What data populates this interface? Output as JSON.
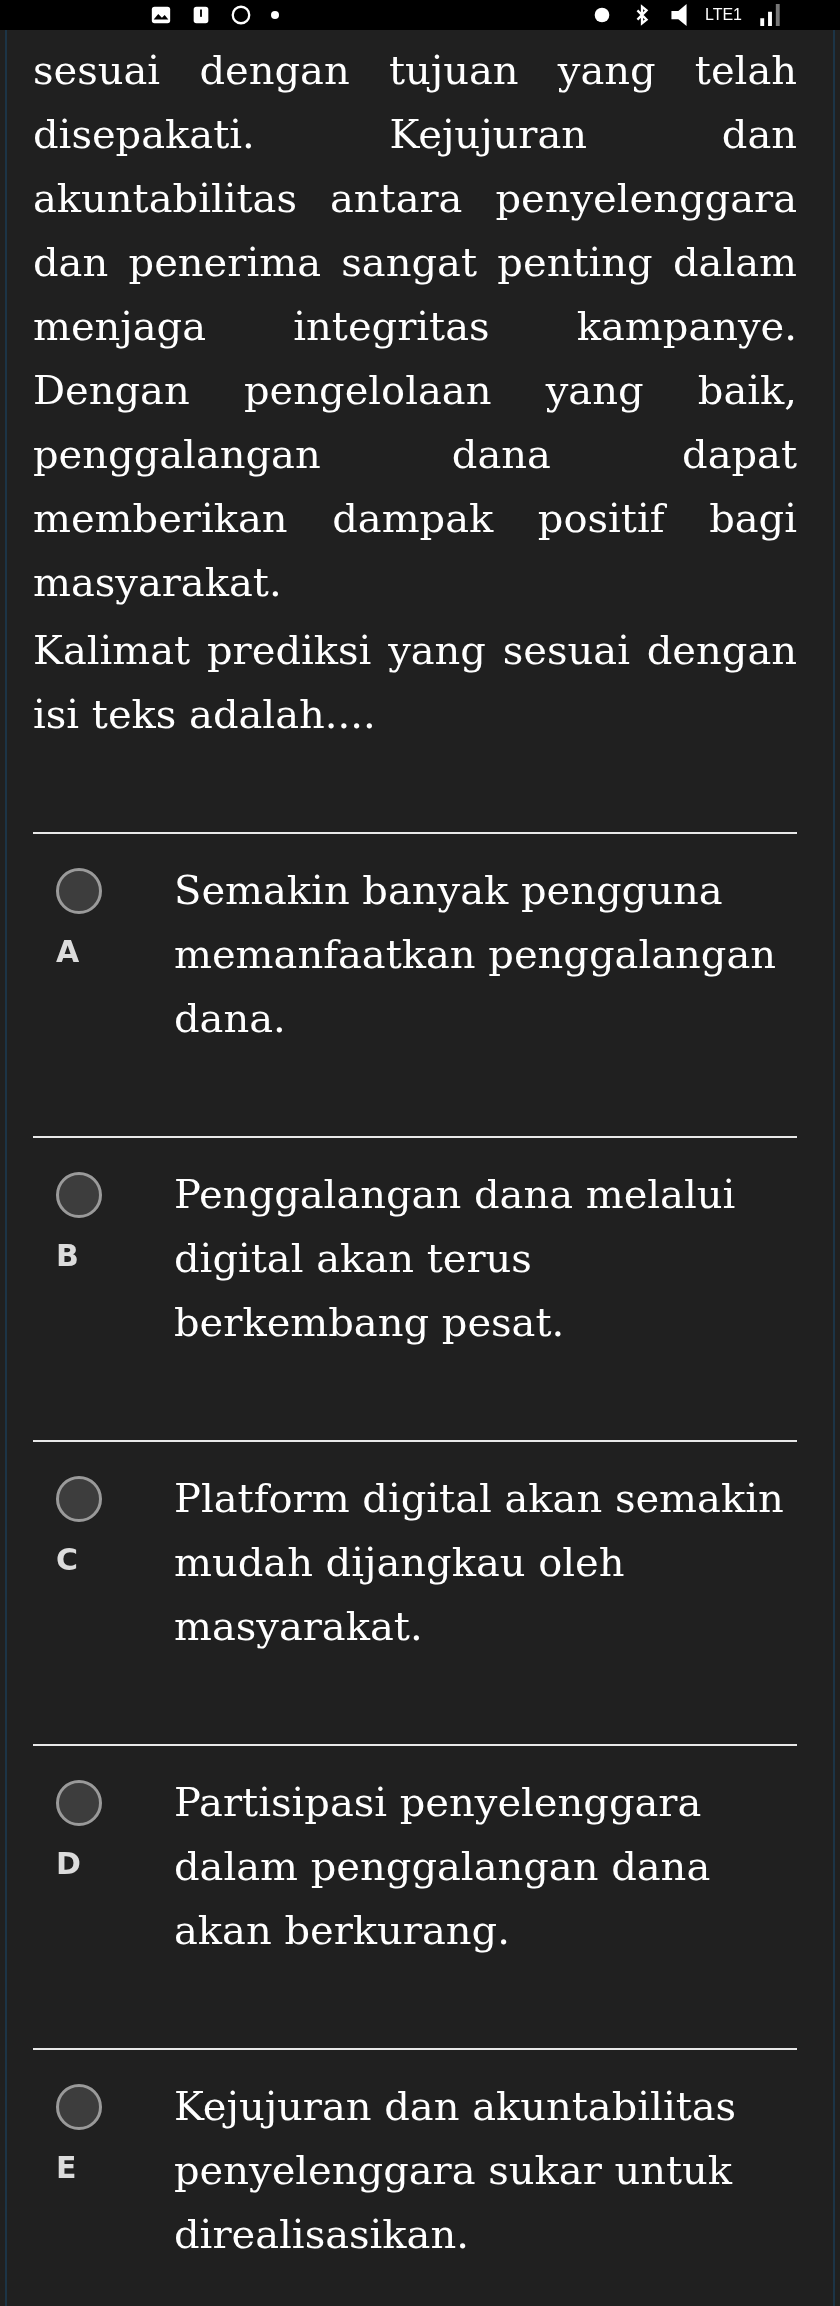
{
  "status_bar": {
    "network": "LTE1"
  },
  "passage": [
    "sesuai dengan tujuan yang telah disepakati. Kejujuran dan akuntabilitas antara penyelenggara dan penerima sangat penting dalam menjaga integritas kampanye. Dengan pengelolaan yang baik, penggalangan dana dapat memberikan dampak positif bagi masyarakat.",
    "Kalimat prediksi yang sesuai dengan isi teks adalah...."
  ],
  "options": [
    {
      "letter": "A",
      "text": "Semakin banyak pengguna memanfaatkan penggalangan dana.",
      "selected": false
    },
    {
      "letter": "B",
      "text": "Penggalangan dana melalui digital akan terus berkembang pesat.",
      "selected": false
    },
    {
      "letter": "C",
      "text": "Platform digital akan semakin mudah dijangkau oleh masyarakat.",
      "selected": false
    },
    {
      "letter": "D",
      "text": "Partisipasi penyelenggara dalam penggalangan dana akan berkurang.",
      "selected": false
    },
    {
      "letter": "E",
      "text": "Kejujuran dan akuntabilitas penyelenggara sukar untuk direalisasikan.",
      "selected": false
    }
  ]
}
